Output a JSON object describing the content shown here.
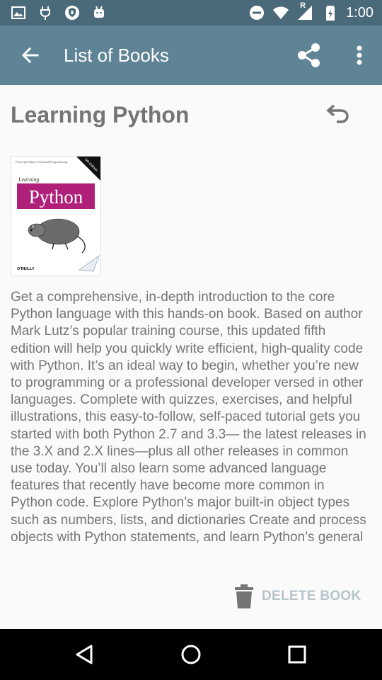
{
  "status_bar": {
    "time": "1:00",
    "left_icons": [
      "image-icon",
      "usb-plug-icon",
      "shield-icon",
      "android-icon"
    ],
    "right_icons": [
      "do-not-disturb-icon",
      "wifi-icon",
      "signal-icon",
      "battery-charging-icon"
    ],
    "signal_label": "R"
  },
  "app_bar": {
    "title": "List of Books",
    "back_icon": "arrow-back-icon",
    "share_icon": "share-icon",
    "more_icon": "more-vert-icon"
  },
  "book": {
    "title": "Learning Python",
    "cover": {
      "series": "Powerful Object-Oriented Programming",
      "subtitle": "Learning",
      "name": "Python",
      "publisher": "O'REILLY",
      "edition": "5th Edition"
    },
    "description": "Get a comprehensive, in-depth introduction to the core Python language with this hands-on book. Based on author Mark Lutz’s popular training course, this updated fifth edition will help you quickly write efficient, high-quality code with Python. It’s an ideal way to begin, whether you’re new to programming or a professional developer versed in other languages. Complete with quizzes, exercises, and helpful illustrations, this easy-to-follow, self-paced tutorial gets you started with both Python 2.7 and 3.3— the latest releases in the 3.X and 2.X lines—plus all other releases in common use today. You’ll also learn some advanced language features that recently have become more common in Python code. Explore Python’s major built-in object types such as numbers, lists, and dictionaries Create and process objects with Python statements, and learn Python’s general"
  },
  "actions": {
    "delete_label": "DELETE BOOK",
    "undo_icon": "undo-icon"
  },
  "colors": {
    "status_bar": "#4a6a7a",
    "app_bar": "#5f8496",
    "delete_text": "#b6c4cb",
    "cover_accent": "#b0207a"
  }
}
